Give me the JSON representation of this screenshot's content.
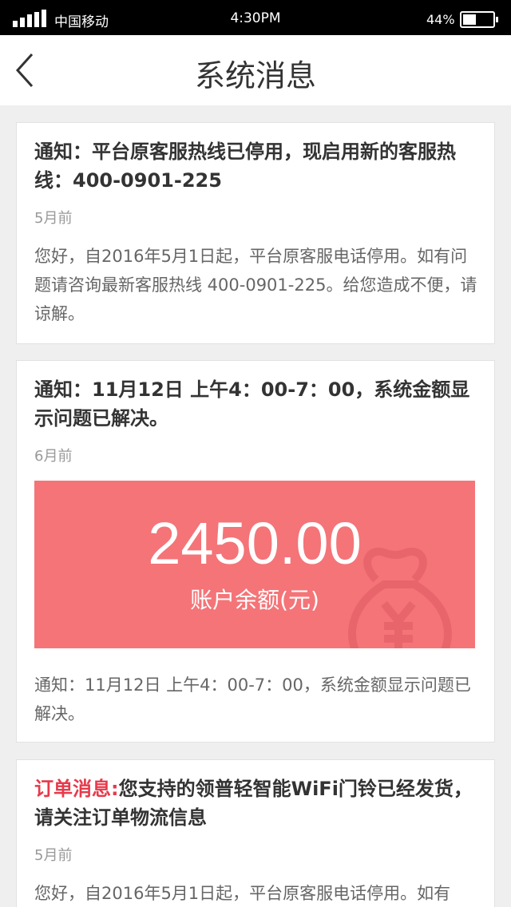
{
  "status_bar": {
    "carrier": "中国移动",
    "time": "4:30PM",
    "battery_pct": "44%",
    "battery_level": 0.44
  },
  "nav": {
    "title": "系统消息",
    "back_icon": "chevron-left-icon"
  },
  "messages": [
    {
      "title": "通知：平台原客服热线已停用，现启用新的客服热线：400-0901-225",
      "time": "5月前",
      "body": "您好，自2016年5月1日起，平台原客服电话停用。如有问题请咨询最新客服热线 400-0901-225。给您造成不便，请谅解。"
    },
    {
      "title": "通知：11月12日 上午4：00-7：00，系统金额显示问题已解决。",
      "time": "6月前",
      "balance": {
        "amount": "2450.00",
        "label": "账户余额(元)",
        "color": "#f47478",
        "icon": "money-bag-icon"
      },
      "body": "通知：11月12日 上午4：00-7：00，系统金额显示问题已解决。"
    },
    {
      "tag": "订单消息:",
      "tag_color": "#e63a4b",
      "title": "您支持的领普轻智能WiFi门铃已经发货，请关注订单物流信息",
      "time": "5月前",
      "body": "您好，自2016年5月1日起，平台原客服电话停用。如有"
    }
  ]
}
